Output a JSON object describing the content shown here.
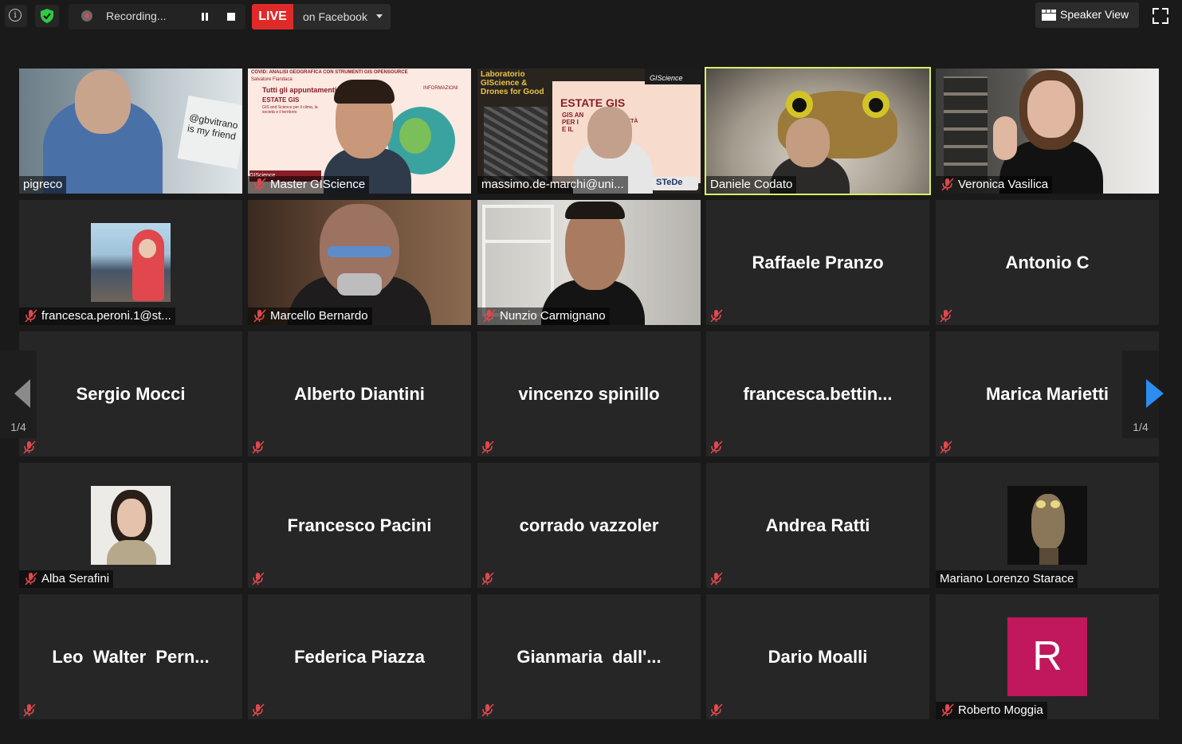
{
  "topbar": {
    "info_icon": "info-icon",
    "shield_icon": "shield-check-icon",
    "recording_label": "Recording...",
    "live_badge": "LIVE",
    "live_destination": "on Facebook",
    "speaker_view_label": "Speaker View",
    "colors": {
      "live": "#e02a2a",
      "shield": "#2ecc40",
      "highlight": "#d9ef6a"
    }
  },
  "pagination": {
    "left": "1/4",
    "right": "1/4"
  },
  "tiles": [
    {
      "name": "pigreco",
      "muted": false,
      "sign_text": "@gbvitrano is my friend"
    },
    {
      "name": "Master GIScience",
      "muted": true,
      "slide_title": "COVID: ANALISI GEOGRAFICA CON STRUMENTI GIS OPENSOURCE",
      "slide_author": "Salvatore Fiandaca",
      "slide_heading": "Tutti gli appuntamenti",
      "slide_sub": "ESTATE GIS",
      "slide_line": "GIS and Science per il clima, la società e il territorio",
      "slide_info": "INFORMAZIONI",
      "slide_logo": "GIScience"
    },
    {
      "name": "massimo.de-marchi@uni...",
      "muted": false,
      "slide_left": "Laboratorio GIScience & Drones for Good",
      "slide_title": "ESTATE GIS",
      "slide_lines": [
        "GIS AN",
        "PER I",
        "E IL",
        "OCIETÀ"
      ],
      "slide_logo": "GIScience",
      "slide_brand": "STeDe"
    },
    {
      "name": "Daniele Codato",
      "muted": false,
      "highlighted": true
    },
    {
      "name": "Veronica Vasilica",
      "muted": true
    },
    {
      "name": "francesca.peroni.1@st...",
      "muted": true
    },
    {
      "name": "Marcello Bernardo",
      "muted": true
    },
    {
      "name": "Nunzio Carmignano",
      "muted": true
    },
    {
      "name": "Raffaele Pranzo",
      "muted": true
    },
    {
      "name": "Antonio C",
      "muted": true
    },
    {
      "name": "Sergio Mocci",
      "muted": true
    },
    {
      "name": "Alberto Diantini",
      "muted": true
    },
    {
      "name": "vincenzo spinillo",
      "muted": true
    },
    {
      "name": "francesca.bettin...",
      "muted": true
    },
    {
      "name": "Marica Marietti",
      "muted": true
    },
    {
      "name": "Alba Serafini",
      "muted": true
    },
    {
      "name": "Francesco Pacini",
      "muted": true
    },
    {
      "name": "corrado vazzoler",
      "muted": true
    },
    {
      "name": "Andrea Ratti",
      "muted": true
    },
    {
      "name": "Mariano Lorenzo Starace",
      "muted": false
    },
    {
      "name": "Leo  Walter  Pern...",
      "muted": true
    },
    {
      "name": "Federica Piazza",
      "muted": true
    },
    {
      "name": "Gianmaria  dall'...",
      "muted": true
    },
    {
      "name": "Dario Moalli",
      "muted": true
    },
    {
      "name": "Roberto Moggia",
      "muted": true,
      "avatar_letter": "R",
      "avatar_color": "#c0175d"
    }
  ]
}
